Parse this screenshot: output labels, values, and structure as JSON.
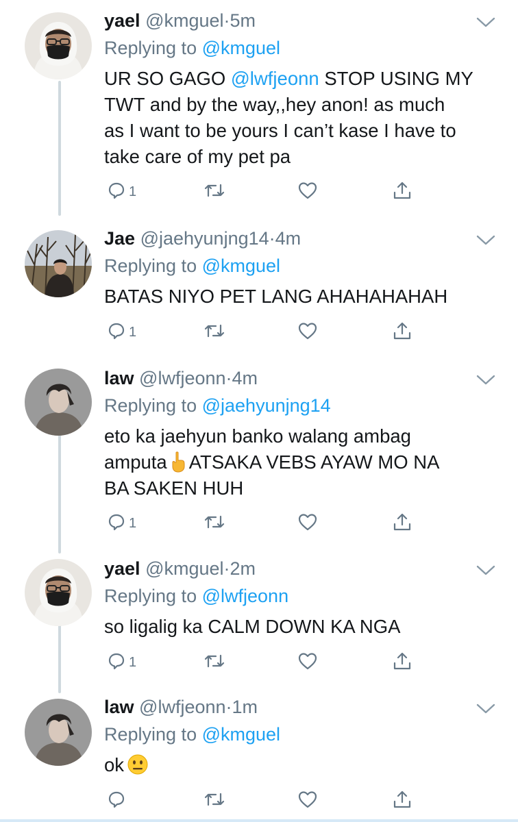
{
  "tweets": [
    {
      "name": "yael",
      "handle": "@kmguel",
      "time": "5m",
      "replying_label": "Replying to",
      "replying_to": "@kmguel",
      "text_lines": [
        {
          "before": "UR SO GAGO ",
          "mention": "@lwfjeonn",
          "after": " STOP USING MY"
        },
        "TWT and by the way,,hey anon! as much",
        "as I want to be yours I can’t kase I have to",
        "take care of my pet pa"
      ],
      "reply_count": "1"
    },
    {
      "name": "Jae",
      "handle": "@jaehyunjng14",
      "time": "4m",
      "replying_label": "Replying to",
      "replying_to": "@kmguel",
      "text_lines": [
        "BATAS NIYO PET LANG AHAHAHAHAH"
      ],
      "reply_count": "1"
    },
    {
      "name": "law",
      "handle": "@lwfjeonn",
      "time": "4m",
      "replying_label": "Replying to",
      "replying_to": "@jaehyunjng14",
      "text_lines": [
        "eto ka jaehyun banko walang ambag",
        {
          "before": "amputa",
          "emoji": "backhand-index-pointing-up",
          "after": "ATSAKA VEBS AYAW MO NA"
        },
        "BA SAKEN HUH"
      ],
      "reply_count": "1"
    },
    {
      "name": "yael",
      "handle": "@kmguel",
      "time": "2m",
      "replying_label": "Replying to",
      "replying_to": "@lwfjeonn",
      "text_lines": [
        "so ligalig ka CALM DOWN KA NGA"
      ],
      "reply_count": "1"
    },
    {
      "name": "law",
      "handle": "@lwfjeonn",
      "time": "1m",
      "replying_label": "Replying to",
      "replying_to": "@kmguel",
      "text_lines": [
        {
          "before": "ok",
          "emoji": "neutral-face",
          "after": ""
        }
      ],
      "reply_count": ""
    }
  ],
  "separator": "·",
  "icons": {
    "reply": "reply-icon",
    "retweet": "retweet-icon",
    "like": "heart-icon",
    "share": "share-icon",
    "more": "chevron-down-icon"
  },
  "colors": {
    "link": "#1da1f2",
    "secondary_text": "#657786",
    "primary_text": "#14171a",
    "thread_line": "#cfd9de"
  }
}
